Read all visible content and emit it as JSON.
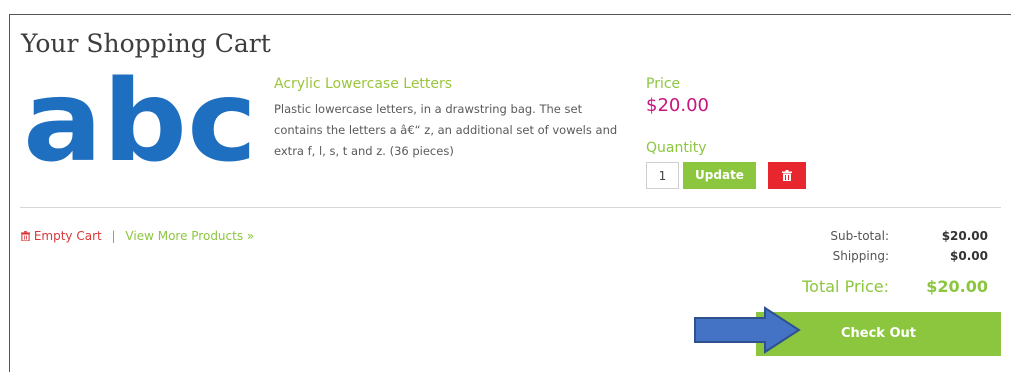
{
  "page": {
    "title": "Your Shopping Cart"
  },
  "product": {
    "image_text": "abc",
    "name": "Acrylic Lowercase Letters",
    "description": "Plastic lowercase letters, in a drawstring bag. The set contains the letters a â€“ z, an additional set of vowels and extra f, l, s, t and z. (36 pieces)",
    "price_label": "Price",
    "price": "$20.00",
    "quantity_label": "Quantity",
    "quantity": "1",
    "update_label": "Update",
    "delete_icon": "trash-icon"
  },
  "links": {
    "empty_cart": "Empty Cart",
    "separator": "|",
    "view_more": "View More Products »"
  },
  "summary": {
    "subtotal_label": "Sub-total:",
    "subtotal": "$20.00",
    "shipping_label": "Shipping:",
    "shipping": "$0.00",
    "total_label": "Total Price:",
    "total": "$20.00"
  },
  "checkout": {
    "label": "Check Out"
  },
  "colors": {
    "accent_green": "#8cc63f",
    "price_magenta": "#c8147e",
    "danger_red": "#e8262d",
    "arrow_blue": "#4472c4",
    "image_blue": "#1f6fc0"
  }
}
